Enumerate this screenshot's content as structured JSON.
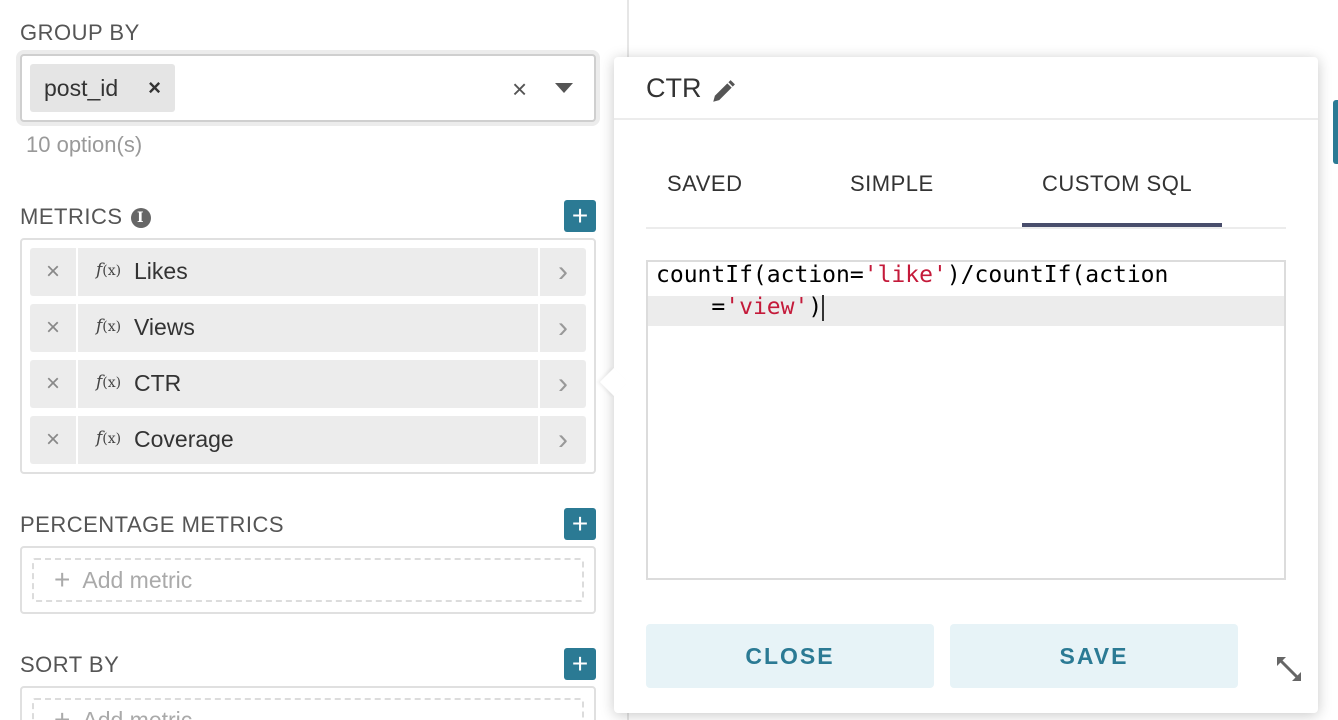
{
  "group_by": {
    "label": "GROUP BY",
    "tag": "post_id",
    "tag_remove": "×",
    "clear": "×",
    "option_count": "10 option(s)"
  },
  "metrics": {
    "label": "METRICS",
    "info_glyph": "i",
    "add_glyph": "+",
    "fx": "f",
    "fx_arg": "(x)",
    "remove_glyph": "×",
    "chevron": "›",
    "items": [
      {
        "label": "Likes"
      },
      {
        "label": "Views"
      },
      {
        "label": "CTR"
      },
      {
        "label": "Coverage"
      }
    ]
  },
  "percentage_metrics": {
    "label": "PERCENTAGE METRICS",
    "add_glyph": "+",
    "placeholder_plus": "+",
    "placeholder": "Add metric"
  },
  "sort_by": {
    "label": "SORT BY",
    "add_glyph": "+",
    "placeholder_plus": "+",
    "placeholder": "Add metric"
  },
  "popover": {
    "title": "CTR",
    "tabs": [
      {
        "label": "SAVED",
        "active": false
      },
      {
        "label": "SIMPLE",
        "active": false
      },
      {
        "label": "CUSTOM SQL",
        "active": true
      }
    ],
    "sql": {
      "line1_a": "countIf(action=",
      "line1_str": "'like'",
      "line1_b": ")/countIf(action",
      "line2_a": "    =",
      "line2_str": "'view'",
      "line2_b": ")"
    },
    "close_label": "CLOSE",
    "save_label": "SAVE"
  },
  "colors": {
    "accent": "#2b7a94",
    "button_bg": "#e7f3f7",
    "tab_active": "#484d6b",
    "sql_string": "#c41a3a"
  },
  "icons": [
    "info-icon",
    "plus-icon",
    "close-icon",
    "chevron-right-icon",
    "chevron-down-icon",
    "pencil-icon",
    "resize-icon"
  ]
}
